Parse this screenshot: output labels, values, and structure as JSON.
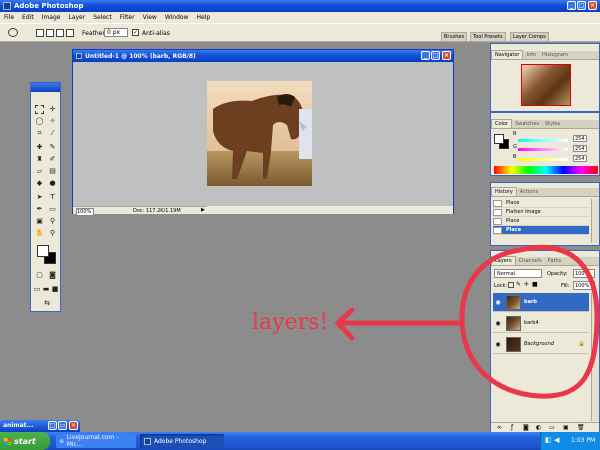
{
  "app": {
    "title": "Adobe Photoshop"
  },
  "menu": [
    "File",
    "Edit",
    "Image",
    "Layer",
    "Select",
    "Filter",
    "View",
    "Window",
    "Help"
  ],
  "options": {
    "feather_label": "Feather:",
    "feather_value": "0 px",
    "antialias_label": "Anti-alias"
  },
  "top_tabs": [
    "Brushes",
    "Tool Presets",
    "Layer Comps"
  ],
  "document": {
    "title": "Untitled-1 @ 100% (barb, RGB/8)",
    "zoom": "100%",
    "doc_info": "Doc: 117.2K/1.19M"
  },
  "navigator": {
    "tabs": [
      "Navigator",
      "Info",
      "Histogram"
    ]
  },
  "color": {
    "tabs": [
      "Color",
      "Swatches",
      "Styles"
    ],
    "channels": [
      {
        "label": "R",
        "value": "254"
      },
      {
        "label": "G",
        "value": "254"
      },
      {
        "label": "B",
        "value": "254"
      }
    ]
  },
  "history": {
    "tabs": [
      "History",
      "Actions"
    ],
    "items": [
      "Place",
      "Flatten Image",
      "Place",
      "Place"
    ]
  },
  "layers": {
    "tabs": [
      "Layers",
      "Channels",
      "Paths"
    ],
    "blend_mode": "Normal",
    "opacity_label": "Opacity:",
    "opacity_value": "100%",
    "lock_label": "Lock:",
    "fill_label": "Fill:",
    "fill_value": "100%",
    "items": [
      {
        "name": "barb",
        "selected": true
      },
      {
        "name": "barb4",
        "selected": false
      },
      {
        "name": "Background",
        "selected": false
      }
    ]
  },
  "annotation": {
    "text": "layers!",
    "color": "#e8384a"
  },
  "minimized": {
    "label": "animat..."
  },
  "taskbar": {
    "start": "start",
    "items": [
      "LiveJournal.com - Mic...",
      "Adobe Photoshop"
    ],
    "time": "1:03 PM"
  },
  "colors": {
    "xp_blue": "#1150d8",
    "selection": "#316ac5",
    "annotation": "#e8384a",
    "canvas_gray": "#8c8c8c"
  }
}
